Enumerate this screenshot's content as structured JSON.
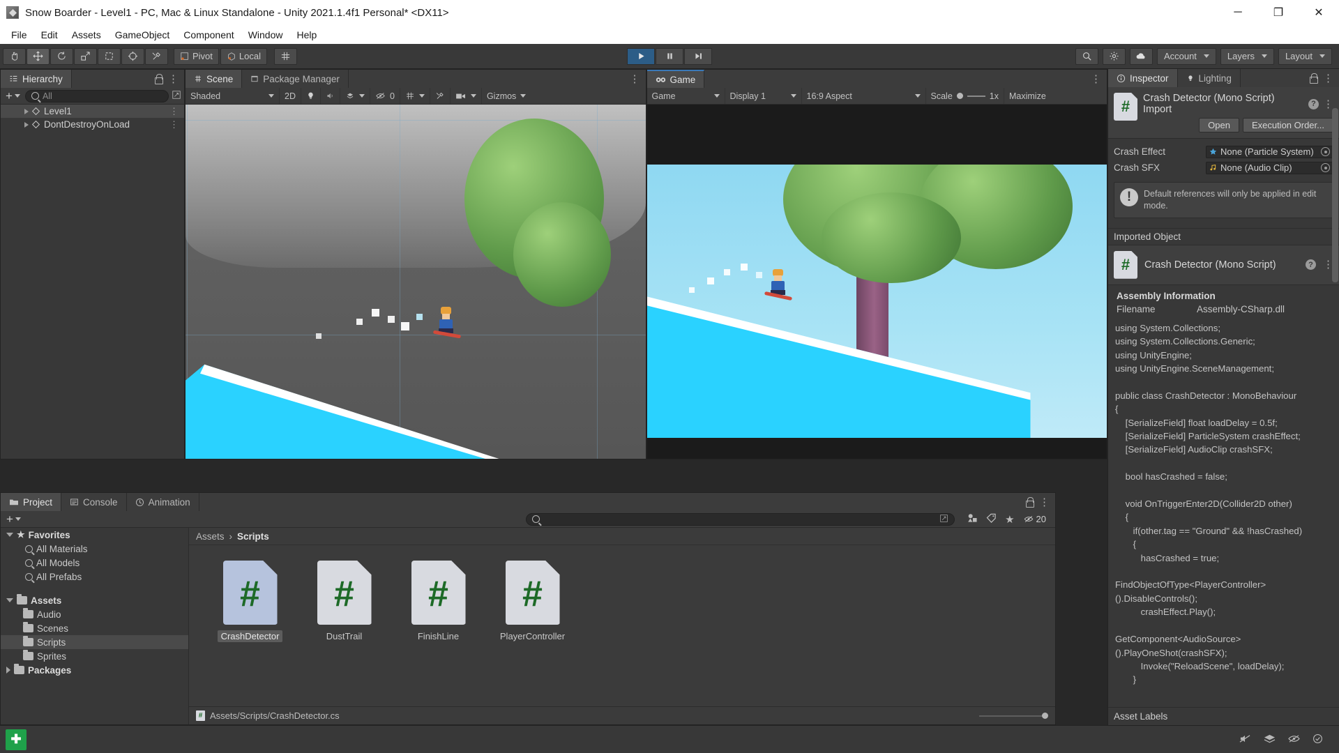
{
  "window": {
    "title": "Snow Boarder - Level1 - PC, Mac & Linux Standalone - Unity 2021.1.4f1 Personal* <DX11>",
    "minimize": "─",
    "maximize": "❐",
    "close": "✕",
    "app_icon": "unity-icon"
  },
  "menubar": {
    "items": [
      "File",
      "Edit",
      "Assets",
      "GameObject",
      "Component",
      "Window",
      "Help"
    ]
  },
  "toolbar": {
    "tools": [
      "hand-tool",
      "move-tool",
      "rotate-tool",
      "scale-tool",
      "rect-tool",
      "transform-tool",
      "custom-tool"
    ],
    "pivot_label": "Pivot",
    "handle_label": "Local",
    "play_label": "play-button",
    "pause_label": "pause-button",
    "step_label": "step-button",
    "search_icon": "search-icon",
    "gizmo_icon": "gizmo-icon",
    "cloud_icon": "cloud-icon",
    "account_label": "Account",
    "layers_label": "Layers",
    "layout_label": "Layout"
  },
  "hierarchy": {
    "tab_label": "Hierarchy",
    "add_label": "+",
    "search_placeholder": "All",
    "items": [
      {
        "label": "Level1",
        "selected": true
      },
      {
        "label": "DontDestroyOnLoad",
        "selected": false
      }
    ]
  },
  "scene": {
    "tabs": [
      {
        "label": "Scene",
        "icon": "scene-icon",
        "active": true
      },
      {
        "label": "Package Manager",
        "icon": "package-icon",
        "active": false
      }
    ],
    "toolbar": {
      "shading_mode": "Shaded",
      "mode_2d": "2D",
      "lighting_icon": "lighting-icon",
      "audio_icon": "audio-icon",
      "fx_icon": "effects-icon",
      "hidden_count": "0",
      "grid_icon": "grid-icon",
      "tools_icon": "tools-icon",
      "camera_icon": "camera-icon",
      "gizmos_label": "Gizmos"
    }
  },
  "game": {
    "tab_label": "Game",
    "tab_icon": "game-icon",
    "toolbar": {
      "view_label": "Game",
      "display_label": "Display 1",
      "aspect_label": "16:9 Aspect",
      "scale_label": "Scale",
      "scale_value": "1x",
      "maximize_label": "Maximize"
    }
  },
  "project": {
    "tabs": [
      {
        "label": "Project",
        "icon": "folder-icon",
        "active": true
      },
      {
        "label": "Console",
        "icon": "console-icon",
        "active": false
      },
      {
        "label": "Animation",
        "icon": "animation-icon",
        "active": false
      }
    ],
    "add_label": "+",
    "search_placeholder": "",
    "filter_icons": [
      "asset-type-filter-icon",
      "label-filter-icon",
      "favorite-filter-icon"
    ],
    "hidden_count": "20",
    "tree": [
      {
        "label": "Favorites",
        "type": "favorites-root",
        "indent": 0,
        "bold": true,
        "expanded": true
      },
      {
        "label": "All Materials",
        "type": "search-item",
        "indent": 1,
        "bold": false
      },
      {
        "label": "All Models",
        "type": "search-item",
        "indent": 1,
        "bold": false
      },
      {
        "label": "All Prefabs",
        "type": "search-item",
        "indent": 1,
        "bold": false
      },
      {
        "label": "",
        "type": "spacer",
        "indent": 0,
        "bold": false
      },
      {
        "label": "Assets",
        "type": "folder-root",
        "indent": 0,
        "bold": true,
        "expanded": true
      },
      {
        "label": "Audio",
        "type": "folder",
        "indent": 1,
        "bold": false
      },
      {
        "label": "Scenes",
        "type": "folder",
        "indent": 1,
        "bold": false
      },
      {
        "label": "Scripts",
        "type": "folder",
        "indent": 1,
        "bold": false,
        "selected": true
      },
      {
        "label": "Sprites",
        "type": "folder",
        "indent": 1,
        "bold": false
      },
      {
        "label": "Packages",
        "type": "folder-root",
        "indent": 0,
        "bold": true,
        "expanded": false
      }
    ],
    "breadcrumb": [
      "Assets",
      "Scripts"
    ],
    "assets": [
      {
        "label": "CrashDetector",
        "icon": "csharp-script-icon",
        "selected": true
      },
      {
        "label": "DustTrail",
        "icon": "csharp-script-icon",
        "selected": false
      },
      {
        "label": "FinishLine",
        "icon": "csharp-script-icon",
        "selected": false
      },
      {
        "label": "PlayerController",
        "icon": "csharp-script-icon",
        "selected": false
      }
    ],
    "status_path": "Assets/Scripts/CrashDetector.cs"
  },
  "inspector": {
    "tabs": [
      {
        "label": "Inspector",
        "icon": "info-icon",
        "active": true
      },
      {
        "label": "Lighting",
        "icon": "lighting-icon",
        "active": false
      }
    ],
    "import_title": "Crash Detector (Mono Script) Import",
    "open_label": "Open",
    "execution_order_label": "Execution Order...",
    "properties": [
      {
        "label": "Crash Effect",
        "value": "None (Particle System)",
        "icon": "particle-system-icon"
      },
      {
        "label": "Crash SFX",
        "value": "None (Audio Clip)",
        "icon": "audio-clip-icon"
      }
    ],
    "helpbox": "Default references will only be applied in edit mode.",
    "imported_object_label": "Imported Object",
    "imported_object_title": "Crash Detector (Mono Script)",
    "assembly_title": "Assembly Information",
    "filename_key": "Filename",
    "filename_value": "Assembly-CSharp.dll",
    "code": "using System.Collections;\nusing System.Collections.Generic;\nusing UnityEngine;\nusing UnityEngine.SceneManagement;\n\npublic class CrashDetector : MonoBehaviour\n{\n    [SerializeField] float loadDelay = 0.5f;\n    [SerializeField] ParticleSystem crashEffect;\n    [SerializeField] AudioClip crashSFX;\n\n    bool hasCrashed = false;\n\n    void OnTriggerEnter2D(Collider2D other)\n    {\n       if(other.tag == \"Ground\" && !hasCrashed)\n       {\n          hasCrashed = true;\n\nFindObjectOfType<PlayerController>().DisableControls();\n          crashEffect.Play();\n\nGetComponent<AudioSource>().PlayOneShot(crashSFX);\n          Invoke(\"ReloadScene\", loadDelay);\n       }\n",
    "asset_labels": "Asset Labels"
  },
  "statusbar": {
    "start_icon": "windows-start-icon",
    "icons": [
      "mute-audio-icon",
      "layers-status-icon",
      "visibility-icon",
      "check-status-icon"
    ]
  },
  "colors": {
    "panel_bg": "#383838",
    "toolbar_bg": "#393939",
    "tab_active": "#4b4b4b",
    "play_active": "#2c5d87",
    "accent_blue": "#3a79b8",
    "snow": "#2ad2ff",
    "csharp_green": "#1d6a27",
    "titlebar_bg": "#ffffff"
  }
}
